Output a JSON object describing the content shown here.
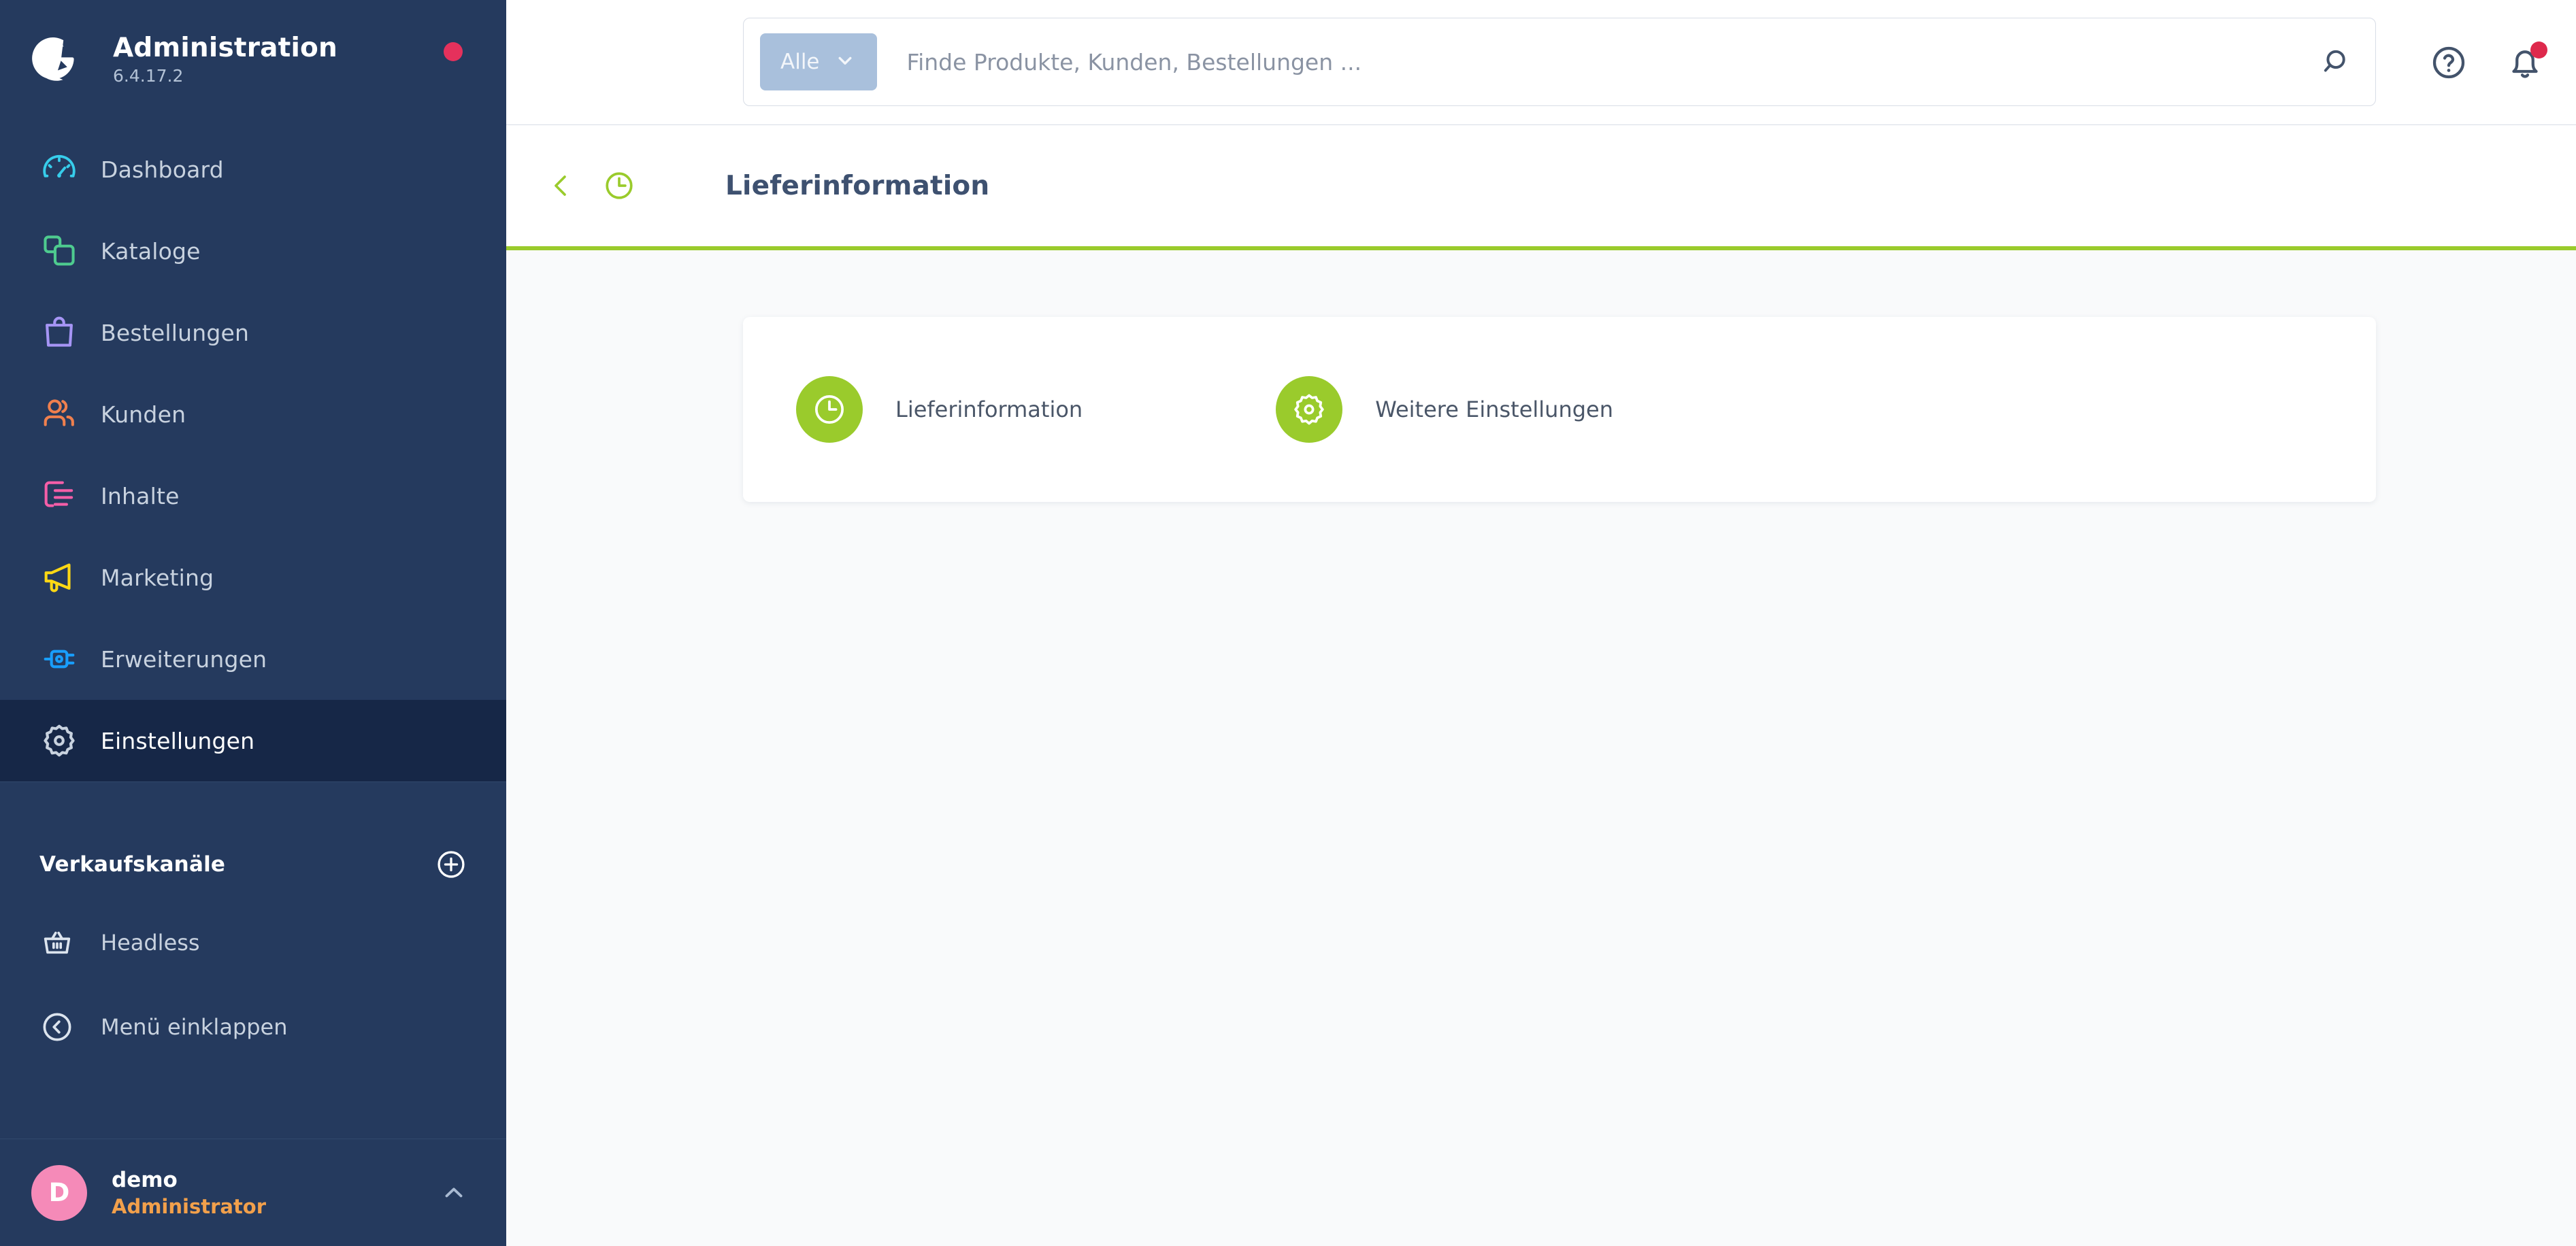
{
  "sidebar": {
    "brand": {
      "logo_icon": "shopware-logo-icon",
      "title": "Administration",
      "version": "6.4.17.2",
      "status_dot": "update-available-dot"
    },
    "nav_items": [
      {
        "label": "Dashboard",
        "icon": "dashboard-icon",
        "color": "#37CDEB",
        "active": false
      },
      {
        "label": "Kataloge",
        "icon": "catalog-icon",
        "color": "#4ECB8F",
        "active": false
      },
      {
        "label": "Bestellungen",
        "icon": "orders-bag-icon",
        "color": "#A695F5",
        "active": false
      },
      {
        "label": "Kunden",
        "icon": "customers-icon",
        "color": "#F0804E",
        "active": false
      },
      {
        "label": "Inhalte",
        "icon": "content-icon",
        "color": "#F55EA8",
        "active": false
      },
      {
        "label": "Marketing",
        "icon": "megaphone-icon",
        "color": "#FFD814",
        "active": false
      },
      {
        "label": "Erweiterungen",
        "icon": "plugin-plug-icon",
        "color": "#189EFF",
        "active": false
      },
      {
        "label": "Einstellungen",
        "icon": "gear-icon",
        "color": "#C8D2DF",
        "active": true
      }
    ],
    "sales_channels": {
      "title": "Verkaufskanäle",
      "add_icon": "plus-circle-icon",
      "items": [
        {
          "label": "Headless",
          "icon": "basket-icon"
        }
      ]
    },
    "collapse": {
      "label": "Menü einklappen",
      "icon": "chevron-left-circle-icon"
    },
    "user": {
      "avatar_initial": "D",
      "avatar_color": "#F58AB8",
      "name": "demo",
      "role": "Administrator",
      "caret_icon": "chevron-up-icon"
    }
  },
  "topbar": {
    "search": {
      "scope_label": "Alle",
      "scope_caret_icon": "chevron-down-icon",
      "value": "",
      "placeholder": "Finde Produkte, Kunden, Bestellungen ...",
      "submit_icon": "search-icon"
    },
    "help_icon": "help-circle-icon",
    "notifications_icon": "bell-icon",
    "notifications_dot": "unread-notification-dot"
  },
  "page_header": {
    "back_icon": "chevron-left-icon",
    "module_icon": "clock-icon",
    "title": "Lieferinformation",
    "accent_color": "#9ACB2C"
  },
  "content": {
    "card_actions": [
      {
        "label": "Lieferinformation",
        "icon": "clock-icon",
        "circle_color": "#9ACB2C"
      },
      {
        "label": "Weitere Einstellungen",
        "icon": "gear-icon",
        "circle_color": "#9ACB2C"
      }
    ]
  }
}
